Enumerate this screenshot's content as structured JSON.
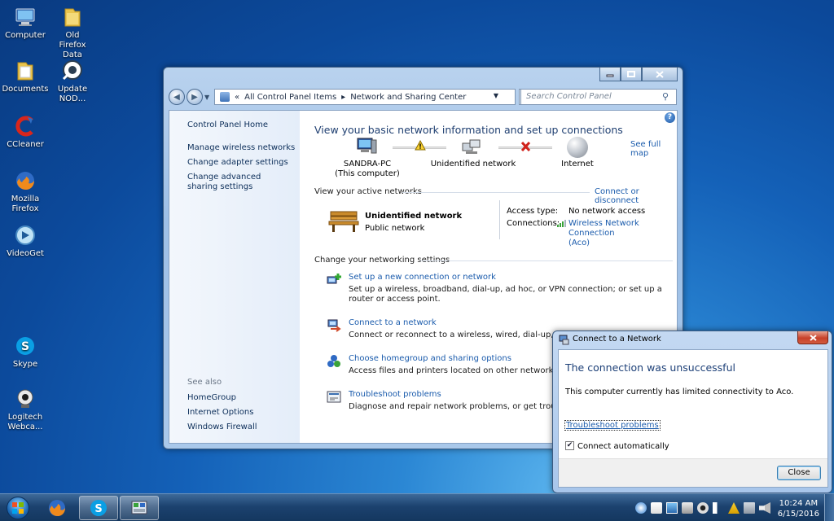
{
  "desktop_icons": [
    {
      "label": "Computer"
    },
    {
      "label": "Old Firefox Data"
    },
    {
      "label": "Documents"
    },
    {
      "label": "Update NOD..."
    },
    {
      "label": "CCleaner"
    },
    {
      "label": "Mozilla Firefox"
    },
    {
      "label": "VideoGet"
    },
    {
      "label": "Skype"
    },
    {
      "label": "Logitech Webca..."
    }
  ],
  "window": {
    "breadcrumb_root": "All Control Panel Items",
    "breadcrumb_current": "Network and Sharing Center",
    "search_placeholder": "Search Control Panel",
    "sidebar": {
      "home": "Control Panel Home",
      "links": [
        "Manage wireless networks",
        "Change adapter settings",
        "Change advanced sharing settings"
      ],
      "see_also_title": "See also",
      "see_also": [
        "HomeGroup",
        "Internet Options",
        "Windows Firewall"
      ]
    },
    "heading": "View your basic network information and set up connections",
    "see_full_map": "See full map",
    "map": {
      "computer": "SANDRA-PC",
      "computer_sub": "(This computer)",
      "network": "Unidentified network",
      "internet": "Internet"
    },
    "active_networks_title": "View your active networks",
    "connect_or_disconnect": "Connect or disconnect",
    "active_network": {
      "name": "Unidentified network",
      "type": "Public network",
      "access_type_label": "Access type:",
      "access_type_value": "No network access",
      "connections_label": "Connections:",
      "connection_name_line1": "Wireless Network Connection",
      "connection_name_line2": "(Aco)"
    },
    "change_settings_title": "Change your networking settings",
    "tasks": [
      {
        "title": "Set up a new connection or network",
        "desc": "Set up a wireless, broadband, dial-up, ad hoc, or VPN connection; or set up a router or access point."
      },
      {
        "title": "Connect to a network",
        "desc": "Connect or reconnect to a wireless, wired, dial-up, or VPN n"
      },
      {
        "title": "Choose homegroup and sharing options",
        "desc": "Access files and printers located on other network compute"
      },
      {
        "title": "Troubleshoot problems",
        "desc": "Diagnose and repair network problems, or get troubleshoot"
      }
    ]
  },
  "dialog": {
    "title": "Connect to a Network",
    "heading": "The connection was unsuccessful",
    "message": "This computer currently has limited connectivity to Aco.",
    "troubleshoot_link": "Troubleshoot problems",
    "connect_auto_label": "Connect automatically",
    "connect_auto_checked": true,
    "close_button": "Close"
  },
  "taskbar": {
    "time": "10:24 AM",
    "date": "6/15/2016"
  }
}
